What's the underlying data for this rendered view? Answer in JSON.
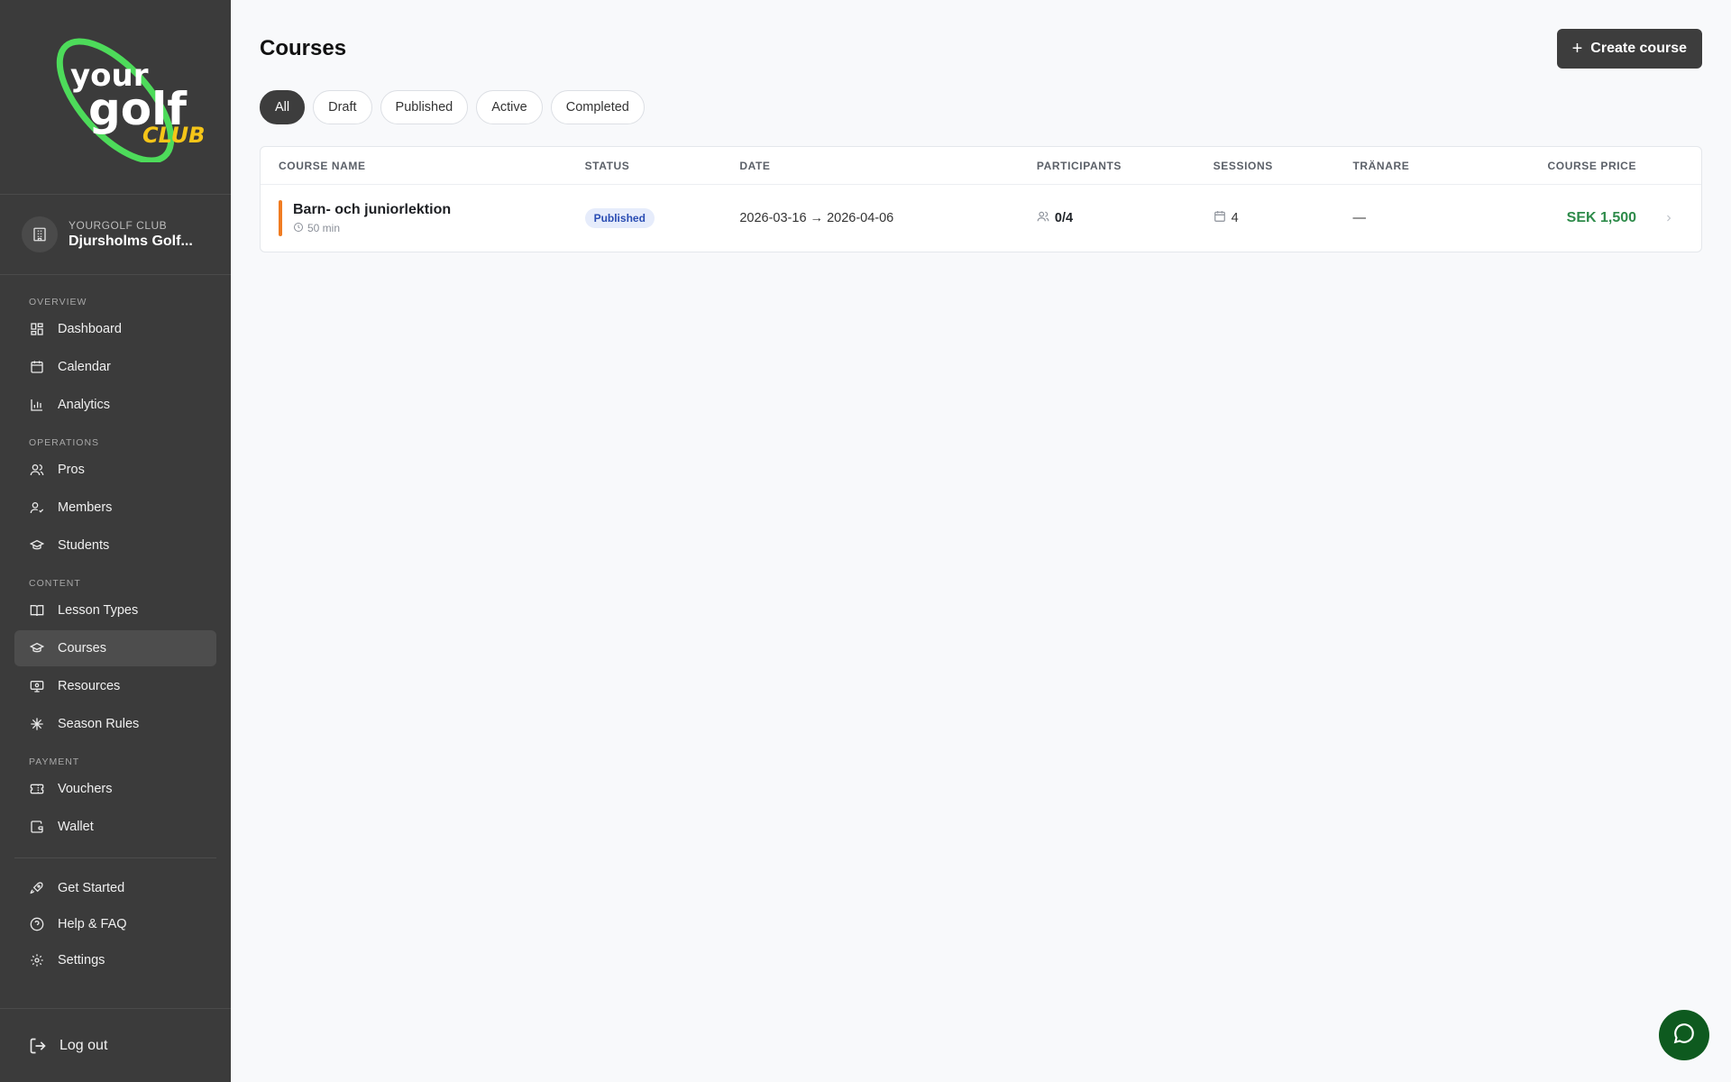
{
  "brand": {
    "logo_word1": "your",
    "logo_word2": "golf",
    "logo_word3": "CLUB"
  },
  "club": {
    "label": "YOURGOLF CLUB",
    "name": "Djursholms Golf..."
  },
  "sidebar": {
    "sections": [
      {
        "label": "OVERVIEW",
        "items": [
          {
            "label": "Dashboard",
            "icon": "dashboard-icon"
          },
          {
            "label": "Calendar",
            "icon": "calendar-icon"
          },
          {
            "label": "Analytics",
            "icon": "analytics-icon"
          }
        ]
      },
      {
        "label": "OPERATIONS",
        "items": [
          {
            "label": "Pros",
            "icon": "users-icon"
          },
          {
            "label": "Members",
            "icon": "user-check-icon"
          },
          {
            "label": "Students",
            "icon": "graduation-cap-icon"
          }
        ]
      },
      {
        "label": "CONTENT",
        "items": [
          {
            "label": "Lesson Types",
            "icon": "book-icon"
          },
          {
            "label": "Courses",
            "icon": "graduation-cap-icon",
            "active": true
          },
          {
            "label": "Resources",
            "icon": "monitor-icon"
          },
          {
            "label": "Season Rules",
            "icon": "snowflake-icon"
          }
        ]
      },
      {
        "label": "PAYMENT",
        "items": [
          {
            "label": "Vouchers",
            "icon": "ticket-icon"
          },
          {
            "label": "Wallet",
            "icon": "wallet-icon"
          }
        ]
      }
    ],
    "bottom": [
      {
        "label": "Get Started",
        "icon": "rocket-icon"
      },
      {
        "label": "Help & FAQ",
        "icon": "help-icon"
      },
      {
        "label": "Settings",
        "icon": "gear-icon"
      }
    ],
    "logout": "Log out"
  },
  "page": {
    "title": "Courses",
    "create_button": "Create course"
  },
  "filters": [
    {
      "label": "All",
      "active": true
    },
    {
      "label": "Draft"
    },
    {
      "label": "Published"
    },
    {
      "label": "Active"
    },
    {
      "label": "Completed"
    }
  ],
  "table": {
    "columns": [
      "COURSE NAME",
      "STATUS",
      "DATE",
      "PARTICIPANTS",
      "SESSIONS",
      "TRÄNARE",
      "COURSE PRICE"
    ],
    "rows": [
      {
        "name": "Barn- och juniorlektion",
        "duration": "50 min",
        "status": "Published",
        "date": "2026-03-16 → 2026-04-06",
        "participants": "0/4",
        "sessions": "4",
        "trainer": "—",
        "price": "SEK 1,500"
      }
    ]
  },
  "colors": {
    "sidebar_bg": "#3b3b3b",
    "accent_orange": "#f07c22",
    "price_green": "#2e8b4a",
    "chat_green": "#0e5a1f",
    "logo_green": "#4ddb5a",
    "logo_yellow": "#f5c518"
  }
}
